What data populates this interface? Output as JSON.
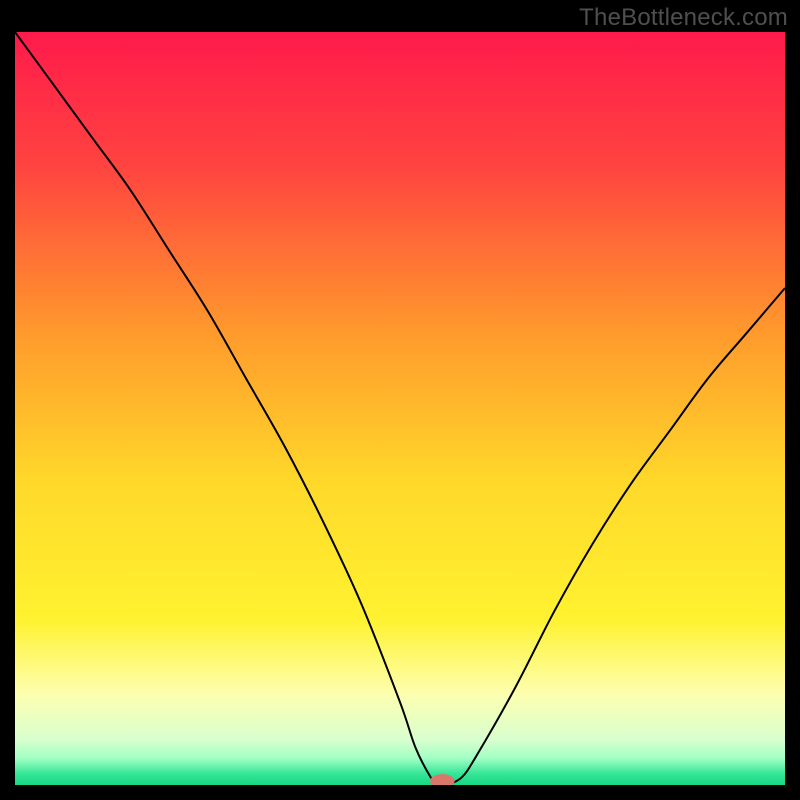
{
  "watermark": "TheBottleneck.com",
  "chart_data": {
    "type": "line",
    "title": "",
    "xlabel": "",
    "ylabel": "",
    "xlim": [
      0,
      100
    ],
    "ylim": [
      0,
      100
    ],
    "grid": false,
    "legend": false,
    "gradient_stops": [
      {
        "offset": 0,
        "color": "#ff1a4b"
      },
      {
        "offset": 0.18,
        "color": "#ff4440"
      },
      {
        "offset": 0.4,
        "color": "#ff9a2c"
      },
      {
        "offset": 0.6,
        "color": "#ffd92a"
      },
      {
        "offset": 0.78,
        "color": "#fff230"
      },
      {
        "offset": 0.88,
        "color": "#fdffb0"
      },
      {
        "offset": 0.94,
        "color": "#d8ffcf"
      },
      {
        "offset": 0.965,
        "color": "#9fffc3"
      },
      {
        "offset": 0.985,
        "color": "#35e697"
      },
      {
        "offset": 1.0,
        "color": "#17d884"
      }
    ],
    "series": [
      {
        "name": "bottleneck-curve",
        "color": "#000000",
        "x": [
          0,
          5,
          10,
          15,
          20,
          25,
          30,
          35,
          40,
          45,
          50,
          52,
          54,
          55,
          56,
          58,
          60,
          65,
          70,
          75,
          80,
          85,
          90,
          95,
          100
        ],
        "y": [
          100,
          93,
          86,
          79,
          71,
          63,
          54,
          45,
          35,
          24,
          11,
          5,
          1,
          0,
          0,
          1,
          4,
          13,
          23,
          32,
          40,
          47,
          54,
          60,
          66
        ]
      }
    ],
    "marker": {
      "name": "optimal-point",
      "x": 55.5,
      "y": 0,
      "rx": 1.6,
      "ry": 0.9,
      "color": "#d8776a"
    }
  }
}
